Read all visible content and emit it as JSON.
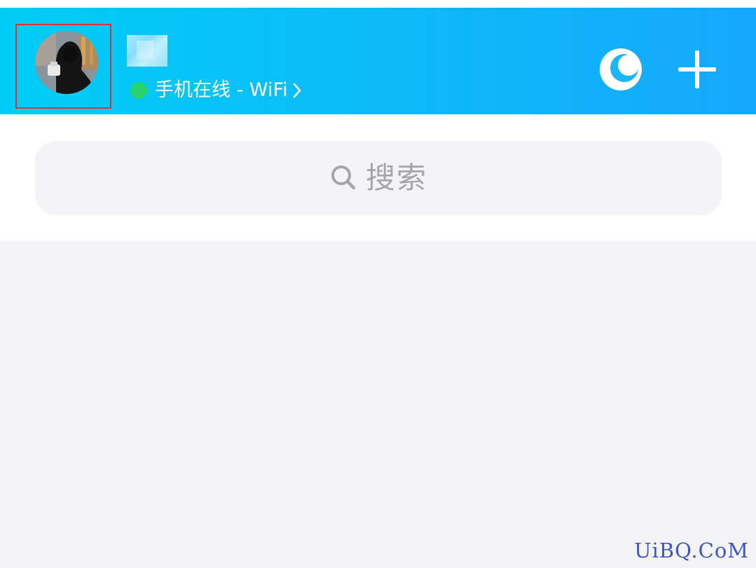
{
  "header": {
    "status": {
      "text": "手机在线 - WiFi",
      "dot_color": "#29d36b"
    },
    "icons": [
      "moon-icon",
      "plus-icon",
      "chevron-right-icon"
    ],
    "gradient": [
      "#00cdf6",
      "#16a8fb"
    ],
    "avatar_highlight_color": "#d8353a"
  },
  "search": {
    "placeholder": "搜索",
    "icon": "search-icon"
  },
  "watermark": {
    "text": "UiBQ.CoM"
  }
}
